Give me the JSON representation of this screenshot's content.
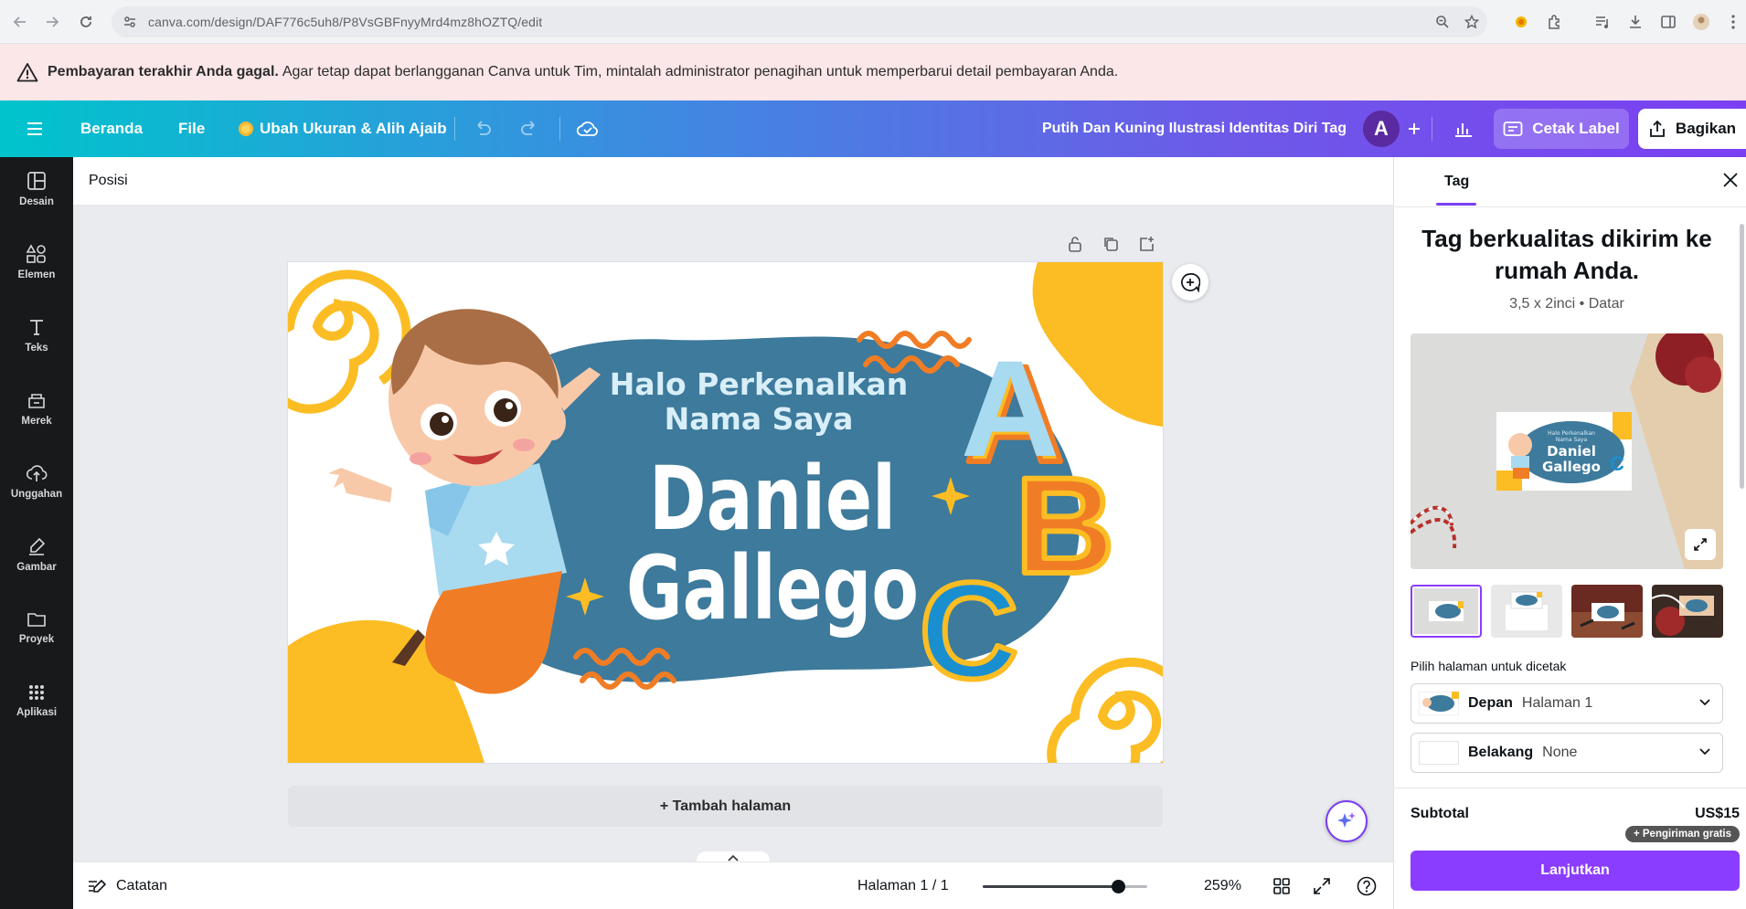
{
  "browser": {
    "url": "canva.com/design/DAF776c5uh8/P8VsGBFnyyMrd4mz8hOZTQ/edit"
  },
  "alert": {
    "bold": "Pembayaran terakhir Anda gagal.",
    "text": "Agar tetap dapat berlangganan Canva untuk Tim, mintalah administrator penagihan untuk memperbarui detail pembayaran Anda."
  },
  "header": {
    "home": "Beranda",
    "file": "File",
    "resize": "Ubah Ukuran & Alih Ajaib",
    "doc_title": "Putih Dan Kuning Ilustrasi Identitas Diri Tag",
    "avatar": "A",
    "print_label": "Cetak Label",
    "share": "Bagikan"
  },
  "sidebar": {
    "items": [
      {
        "label": "Desain"
      },
      {
        "label": "Elemen"
      },
      {
        "label": "Teks"
      },
      {
        "label": "Merek"
      },
      {
        "label": "Unggahan"
      },
      {
        "label": "Gambar"
      },
      {
        "label": "Proyek"
      },
      {
        "label": "Aplikasi"
      }
    ]
  },
  "toolbar": {
    "position": "Posisi"
  },
  "design": {
    "greeting_line1": "Halo Perkenalkan",
    "greeting_line2": "Nama Saya",
    "first_name": "Daniel",
    "last_name": "Gallego",
    "letter_a": "A",
    "letter_b": "B",
    "letter_c": "C"
  },
  "canvas": {
    "add_page": "+ Tambah halaman"
  },
  "footer": {
    "notes": "Catatan",
    "page": "Halaman 1 / 1",
    "zoom": "259%",
    "zoom_fraction": 0.82
  },
  "panel": {
    "tab": "Tag",
    "title": "Tag berkualitas dikirim ke rumah Anda.",
    "subtitle": "3,5 x 2inci • Datar",
    "mockup": {
      "line1": "Halo Perkenalkan",
      "line2": "Nama Saya",
      "name1": "Daniel",
      "name2": "Gallego"
    },
    "pick_label": "Pilih halaman untuk dicetak",
    "front_label": "Depan",
    "front_value": "Halaman 1",
    "back_label": "Belakang",
    "back_value": "None",
    "subtotal_label": "Subtotal",
    "subtotal_value": "US$15",
    "shipping_badge": "+ Pengiriman gratis",
    "continue": "Lanjutkan"
  },
  "colors": {
    "accent": "#8b3dff",
    "design_blob": "#3d7a9c",
    "design_yellow": "#fbbd23",
    "design_orange": "#f07d25",
    "alert_bg": "#fbe6e8"
  }
}
